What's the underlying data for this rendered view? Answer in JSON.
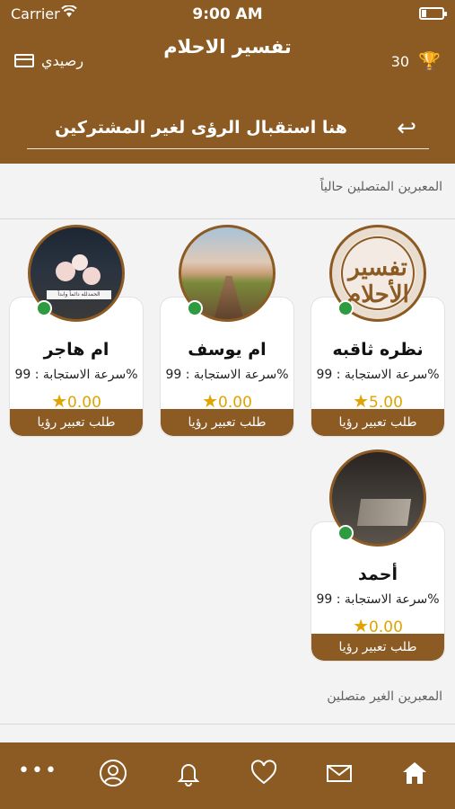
{
  "status_bar": {
    "carrier": "Carrier",
    "time": "9:00 AM"
  },
  "header": {
    "title": "تفسير الاحلام",
    "balance_label": "رصيدي",
    "score": "30",
    "banner_text": "هنا استقبال الرؤى لغير المشتركين"
  },
  "sections": {
    "online_title": "المعبرين المتصلين حالياً",
    "offline_title": "المعبرين الغير متصلين"
  },
  "interpreters": [
    {
      "name": "نظره ثاقبه",
      "response_speed": "سرعة الاستجابة : 99%",
      "rating": "5.00",
      "button_label": "طلب تعبير رؤيا",
      "avatar_text": "تفسير الأحلام"
    },
    {
      "name": "ام يوسف",
      "response_speed": "سرعة الاستجابة : 99%",
      "rating": "0.00",
      "button_label": "طلب تعبير رؤيا"
    },
    {
      "name": "ام هاجر",
      "response_speed": "سرعة الاستجابة : 99%",
      "rating": "0.00",
      "button_label": "طلب تعبير رؤيا",
      "avatar_caption": "الحمدلله دائماً وابداً"
    },
    {
      "name": "أحمد",
      "response_speed": "سرعة الاستجابة : 99%",
      "rating": "0.00",
      "button_label": "طلب تعبير رؤيا"
    }
  ],
  "colors": {
    "brand": "#8c5a23",
    "online": "#2e9b40",
    "star": "#e0a300"
  },
  "tabbar": {
    "icons": [
      "more-icon",
      "profile-icon",
      "bell-icon",
      "heart-icon",
      "mail-icon",
      "home-icon"
    ]
  }
}
